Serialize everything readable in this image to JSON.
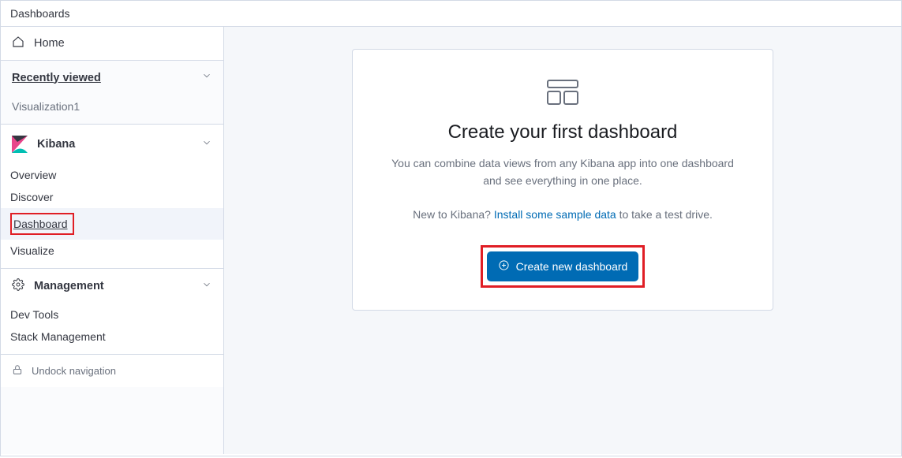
{
  "topbar": {
    "breadcrumb": "Dashboards"
  },
  "sidebar": {
    "home_label": "Home",
    "recently_viewed": {
      "title": "Recently viewed",
      "items": [
        "Visualization1"
      ]
    },
    "kibana": {
      "title": "Kibana",
      "items": [
        "Overview",
        "Discover",
        "Dashboard",
        "Visualize"
      ],
      "active": "Dashboard"
    },
    "management": {
      "title": "Management",
      "items": [
        "Dev Tools",
        "Stack Management"
      ]
    },
    "undock_label": "Undock navigation"
  },
  "main": {
    "heading": "Create your first dashboard",
    "description_line1": "You can combine data views from any Kibana app into one dashboard",
    "description_line2": "and see everything in one place.",
    "sample_prefix": "New to Kibana? ",
    "sample_link": "Install some sample data",
    "sample_suffix": " to take a test drive.",
    "cta_label": "Create new dashboard"
  }
}
